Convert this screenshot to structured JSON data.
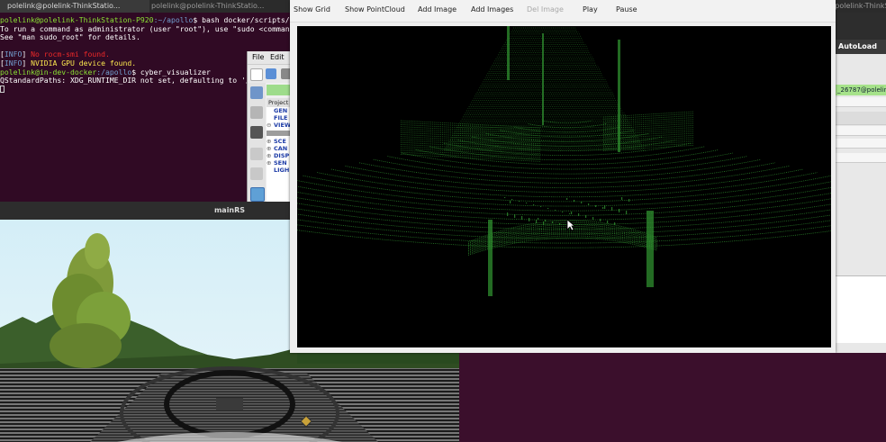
{
  "terminal_tabs": [
    {
      "label": "polelink@polelink-ThinkStatio..."
    },
    {
      "label": "polelink@polelink-ThinkStatio..."
    },
    {
      "label": "polelink@polelink-ThinkStati"
    }
  ],
  "terminal": {
    "lines": [
      {
        "prefix": "polelink@polelink-ThinkStation-P920",
        "path": ":~/apollo",
        "text": "$ bash docker/scripts/d"
      },
      {
        "text": "To run a command as administrator (user \"root\"), use \"sudo <command"
      },
      {
        "text": "See \"man sudo_root\" for details."
      },
      {
        "text": ""
      },
      {
        "tag": "INFO",
        "text": " No rocm-smi found."
      },
      {
        "tag": "INFO",
        "text": " NVIDIA GPU device found."
      },
      {
        "prefix": "polelink@in-dev-docker",
        "path": ":/apollo",
        "text": "$ cyber_visualizer"
      },
      {
        "text": "QStandardPaths: XDG_RUNTIME_DIR not set, defaulting to '/"
      }
    ]
  },
  "mid_app": {
    "menu": [
      "File",
      "Edit"
    ],
    "tree_header": "Project",
    "tree_items": [
      {
        "pm": "",
        "label": "GEN"
      },
      {
        "pm": "",
        "label": "FILE"
      },
      {
        "pm": "⊖",
        "label": "VIEW"
      },
      {
        "pm": "⊕",
        "label": "SCE"
      },
      {
        "pm": "⊕",
        "label": "CAN"
      },
      {
        "pm": "⊕",
        "label": "DISP"
      },
      {
        "pm": "⊕",
        "label": "SEN"
      },
      {
        "pm": "",
        "label": "LIGH"
      }
    ]
  },
  "mainrs": {
    "title": "mainRS"
  },
  "visualizer": {
    "toolbar": {
      "show_grid": "Show Grid",
      "show_pointcloud": "Show PointCloud",
      "add_image": "Add Image",
      "add_images": "Add Images",
      "del_image": "Del Image",
      "play": "Play",
      "pause": "Pause"
    },
    "colors": {
      "pointcloud": "#2f8f2f",
      "canvas_bg": "#000000"
    }
  },
  "right_app": {
    "title": "AutoLoad",
    "channel": "_26787@polelin"
  }
}
